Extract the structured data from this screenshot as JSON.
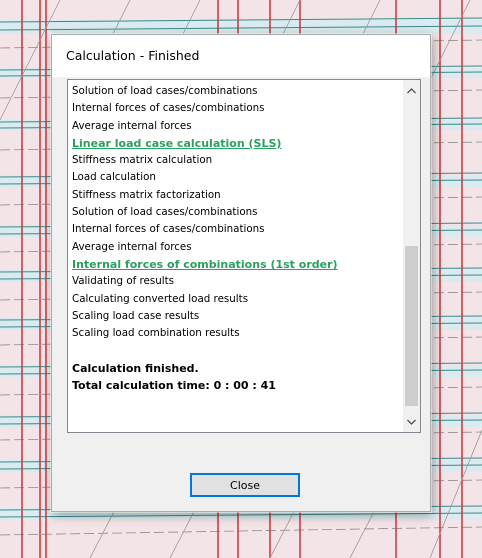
{
  "dialog": {
    "title": "Calculation - Finished",
    "log_lines": [
      {
        "text": "Solution of load cases/combinations",
        "style": "normal"
      },
      {
        "text": "Internal forces of cases/combinations",
        "style": "normal"
      },
      {
        "text": "Average internal forces",
        "style": "normal"
      },
      {
        "text": "Linear load case calculation (SLS)",
        "style": "heading"
      },
      {
        "text": "Stiffness matrix calculation",
        "style": "normal"
      },
      {
        "text": "Load calculation",
        "style": "normal"
      },
      {
        "text": "Stiffness matrix factorization",
        "style": "normal"
      },
      {
        "text": "Solution of load cases/combinations",
        "style": "normal"
      },
      {
        "text": "Internal forces of cases/combinations",
        "style": "normal"
      },
      {
        "text": "Average internal forces",
        "style": "normal"
      },
      {
        "text": "Internal forces of combinations (1st order)",
        "style": "heading"
      },
      {
        "text": "Validating of results",
        "style": "normal"
      },
      {
        "text": "Calculating converted load results",
        "style": "normal"
      },
      {
        "text": "Scaling load case results",
        "style": "normal"
      },
      {
        "text": "Scaling load combination results",
        "style": "normal"
      },
      {
        "text": "",
        "style": "blank"
      },
      {
        "text": "Calculation finished.",
        "style": "final"
      },
      {
        "text": "Total calculation time:  0 : 00 : 41",
        "style": "final"
      }
    ],
    "close_label": "Close"
  },
  "icons": {
    "scroll_up": "chevron-up-icon",
    "scroll_down": "chevron-down-icon"
  },
  "colors": {
    "heading": "#2aa05f",
    "button_border": "#0078d7",
    "dialog_bg": "#f0f0f0"
  }
}
